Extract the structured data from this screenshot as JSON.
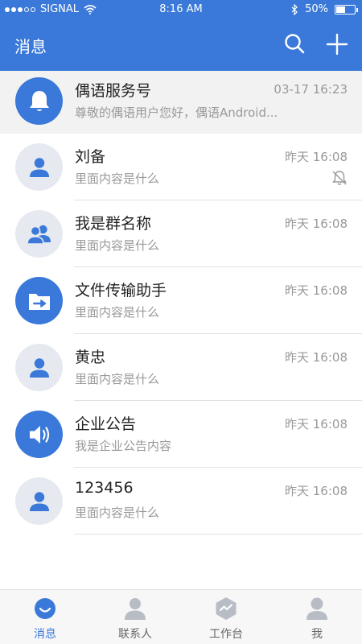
{
  "status_bar": {
    "carrier": "SIGNAL",
    "time": "8:16 AM",
    "battery": "50%",
    "battery_level": 0.5
  },
  "header": {
    "title": "消息",
    "search_icon": "search-icon",
    "add_icon": "plus-icon"
  },
  "conversations": [
    {
      "name": "偶语服务号",
      "preview": "尊敬的偶语用户您好，偶语Android...",
      "time": "03-17  16:23",
      "icon": "bell-icon",
      "pinned": true
    },
    {
      "name": "刘备",
      "preview": "里面内容是什么",
      "time": "昨天 16:08",
      "icon": "user-icon",
      "muted": true
    },
    {
      "name": "我是群名称",
      "preview": "里面内容是什么",
      "time": "昨天 16:08",
      "icon": "group-icon"
    },
    {
      "name": "文件传输助手",
      "preview": "里面内容是什么",
      "time": "昨天 16:08",
      "icon": "folder-transfer-icon"
    },
    {
      "name": "黄忠",
      "preview": "里面内容是什么",
      "time": "昨天 16:08",
      "icon": "user-icon"
    },
    {
      "name": "企业公告",
      "preview": "我是企业公告内容",
      "time": "昨天 16:08",
      "icon": "speaker-icon"
    },
    {
      "name": "123456",
      "preview": "里面内容是什么",
      "time": "昨天 16:08",
      "icon": "user-icon"
    }
  ],
  "tabs": [
    {
      "label": "消息",
      "icon": "message-icon",
      "active": true
    },
    {
      "label": "联系人",
      "icon": "contacts-icon"
    },
    {
      "label": "工作台",
      "icon": "workbench-icon"
    },
    {
      "label": "我",
      "icon": "profile-icon"
    }
  ],
  "colors": {
    "primary": "#3a79d9",
    "avatar_grey": "#e6e9ef",
    "secondary_text": "#999999",
    "tab_inactive_icon": "#b8bcc4"
  }
}
